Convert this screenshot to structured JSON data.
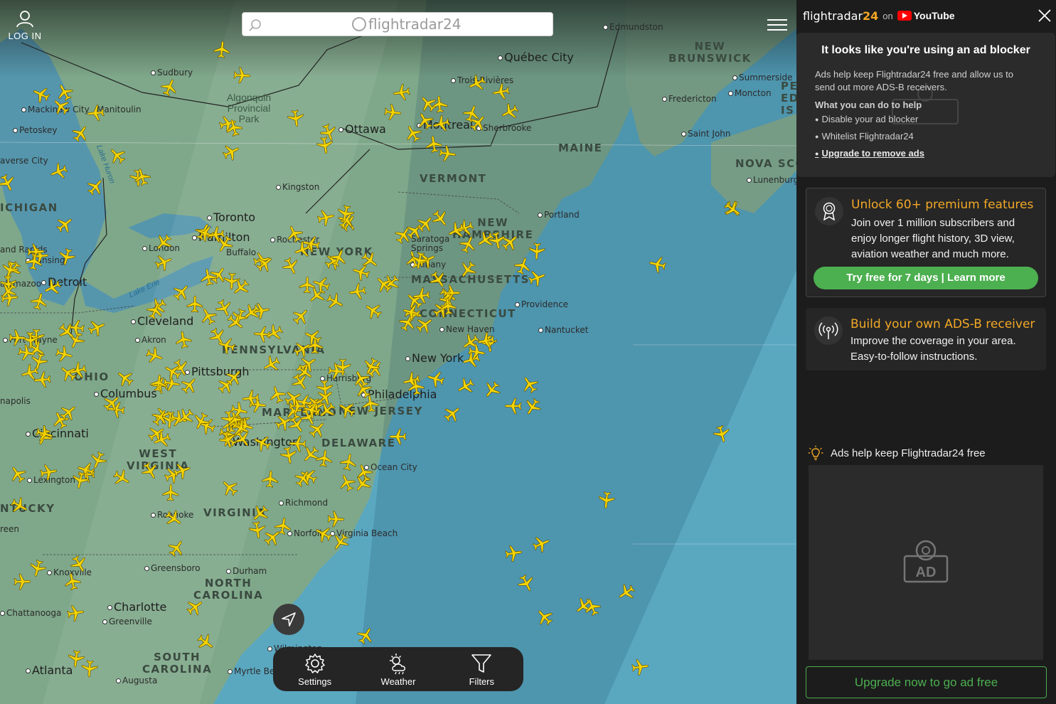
{
  "header": {
    "login_label": "LOG IN",
    "search_placeholder": "",
    "brand": "flightradar24"
  },
  "map": {
    "cities": [
      {
        "name": "Québec City",
        "big": true
      },
      {
        "name": "Trois-Rivières"
      },
      {
        "name": "Montreal",
        "big": true
      },
      {
        "name": "Ottawa",
        "big": true
      },
      {
        "name": "Sherbrooke"
      },
      {
        "name": "Edmundston"
      },
      {
        "name": "Fredericton"
      },
      {
        "name": "Moncton"
      },
      {
        "name": "Summerside"
      },
      {
        "name": "Saint John"
      },
      {
        "name": "Lunenburg"
      },
      {
        "name": "Sudbury"
      },
      {
        "name": "Mackinaw City"
      },
      {
        "name": "Petoskey"
      },
      {
        "name": "Kingston"
      },
      {
        "name": "Toronto",
        "big": true
      },
      {
        "name": "Hamilton",
        "big": true
      },
      {
        "name": "London"
      },
      {
        "name": "Rochester"
      },
      {
        "name": "Detroit",
        "big": true
      },
      {
        "name": "Lansing"
      },
      {
        "name": "Cleveland",
        "big": true
      },
      {
        "name": "Akron"
      },
      {
        "name": "Fort Wayne"
      },
      {
        "name": "Pittsburgh",
        "big": true
      },
      {
        "name": "Columbus",
        "big": true
      },
      {
        "name": "Cincinnati",
        "big": true
      },
      {
        "name": "Lexington"
      },
      {
        "name": "Portland"
      },
      {
        "name": "Providence"
      },
      {
        "name": "New Haven"
      },
      {
        "name": "Nantucket"
      },
      {
        "name": "Albany"
      },
      {
        "name": "Harrisburg"
      },
      {
        "name": "Philadelphia",
        "big": true
      },
      {
        "name": "New York",
        "big": true
      },
      {
        "name": "Washington",
        "big": true
      },
      {
        "name": "Ocean City"
      },
      {
        "name": "Richmond"
      },
      {
        "name": "Roanoke"
      },
      {
        "name": "Norfolk"
      },
      {
        "name": "Virginia Beach"
      },
      {
        "name": "Knoxville"
      },
      {
        "name": "Greensboro"
      },
      {
        "name": "Durham"
      },
      {
        "name": "Charlotte",
        "big": true
      },
      {
        "name": "Greenville"
      },
      {
        "name": "Chattanooga"
      },
      {
        "name": "Atlanta",
        "big": true
      },
      {
        "name": "Augusta"
      },
      {
        "name": "Myrtle Beach"
      },
      {
        "name": "Wilmington"
      },
      {
        "name": "Buffalo"
      },
      {
        "name": "Saratoga Springs"
      },
      {
        "name": "Manitoulin"
      },
      {
        "name": "averse City"
      },
      {
        "name": "and Rapids"
      },
      {
        "name": "alamazoo"
      },
      {
        "name": "napolis"
      },
      {
        "name": "reen"
      }
    ],
    "regions": [
      "NEW BRUNSWICK",
      "MAINE",
      "NOVA SCO",
      "PE ED IS",
      "VERMONT",
      "NEW HAMPSHIRE",
      "NEW YORK",
      "MASSACHUSETTS",
      "CONNECTICUT",
      "PENNSYLVANIA",
      "NEW JERSEY",
      "MARYLAND",
      "DELAWARE",
      "OHIO",
      "WEST VIRGINIA",
      "VIRGINIA",
      "NORTH CAROLINA",
      "SOUTH CAROLINA",
      "ICHIGAN",
      "NTUCKY"
    ],
    "water": [
      "Lake Huron",
      "Lake Erie"
    ],
    "park": "Algonquin Provincial Park",
    "plane_color": "#f5d400"
  },
  "toolbar": {
    "settings": "Settings",
    "weather": "Weather",
    "filters": "Filters"
  },
  "sidebar": {
    "brand": "flightradar",
    "brand_num": "24",
    "on": "on",
    "youtube": "YouTube",
    "adblock": {
      "title": "It looks like you're using an ad blocker",
      "desc": "Ads help keep Flightradar24 free and allow us to send out more ADS-B receivers.",
      "help": "What you can do to help",
      "items": [
        "Disable your ad blocker",
        "Whitelist Flightradar24",
        "Upgrade to remove ads"
      ]
    },
    "premium": {
      "title": "Unlock 60+ premium features",
      "text": "Join over 1 million subscribers and enjoy longer flight history, 3D view, aviation weather and much more.",
      "button": "Try free for 7 days | Learn more"
    },
    "adsb": {
      "title": "Build your own ADS-B receiver",
      "text": "Improve the coverage in your area. Easy-to-follow instructions."
    },
    "ads_free": "Ads help keep Flightradar24 free",
    "ad_label": "AD",
    "upgrade": "Upgrade now to go ad free",
    "accent": "#f2a826",
    "green": "#4caf50"
  }
}
